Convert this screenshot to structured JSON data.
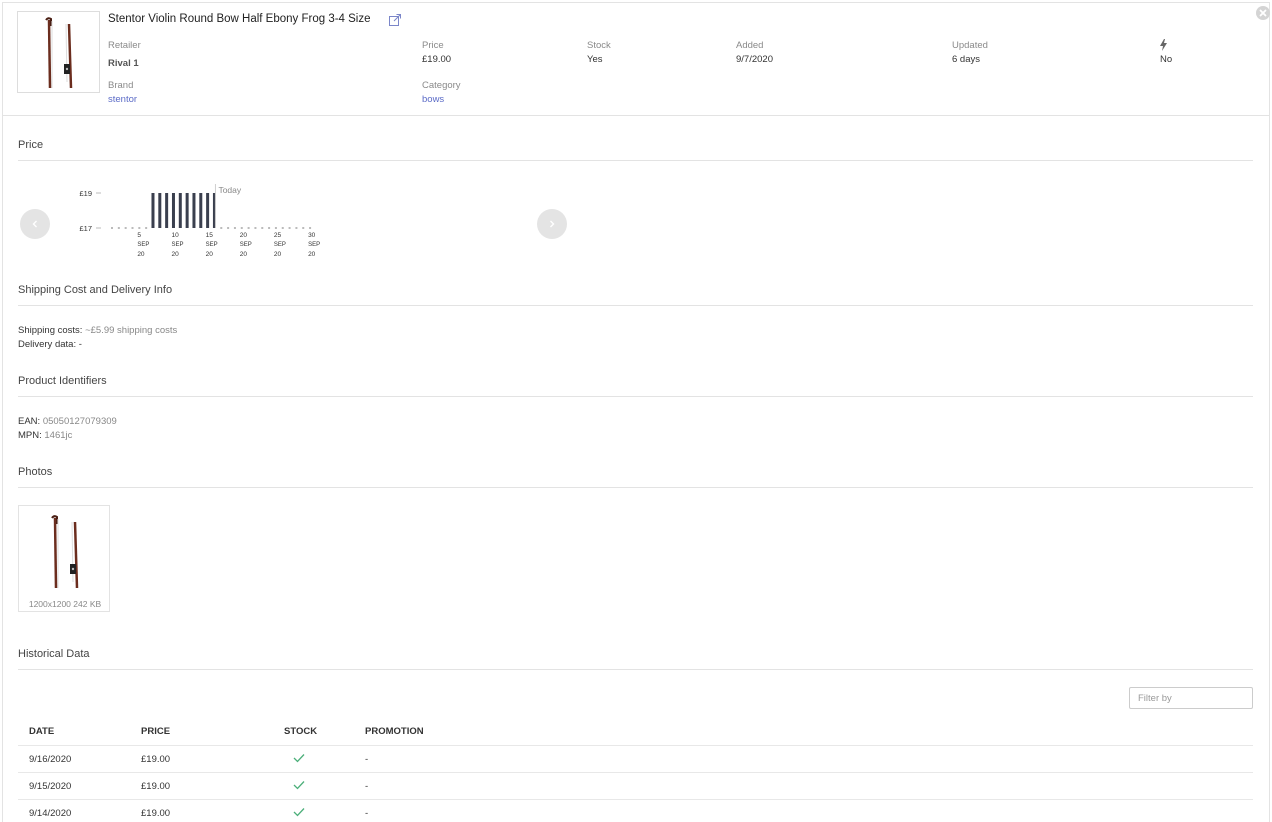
{
  "product": {
    "title": "Stentor Violin Round Bow Half Ebony Frog 3-4 Size",
    "fields": {
      "retailer_label": "Retailer",
      "retailer_value": "Rival 1",
      "price_label": "Price",
      "price_value": "£19.00",
      "stock_label": "Stock",
      "stock_value": "Yes",
      "added_label": "Added",
      "added_value": "9/7/2020",
      "updated_label": "Updated",
      "updated_value": "6 days",
      "promo_value": "No",
      "brand_label": "Brand",
      "brand_value": "stentor",
      "category_label": "Category",
      "category_value": "bows"
    },
    "icons": {
      "external": "external-link-icon",
      "promo": "lightning-bolt-icon",
      "close": "close-icon"
    }
  },
  "sections": {
    "price": "Price",
    "shipping": "Shipping Cost and Delivery Info",
    "identifiers": "Product Identifiers",
    "photos": "Photos",
    "history": "Historical Data"
  },
  "chart_data": {
    "type": "bar",
    "y_tick_labels": [
      "£19",
      "£17"
    ],
    "ylim": [
      17,
      19
    ],
    "today_label": "Today",
    "x_tick_days": [
      "5",
      "10",
      "15",
      "20",
      "25",
      "30"
    ],
    "x_tick_month": "SEP",
    "x_tick_year": "20",
    "days": [
      1,
      2,
      3,
      4,
      5,
      6,
      7,
      8,
      9,
      10,
      11,
      12,
      13,
      14,
      15,
      16,
      17,
      18,
      19,
      20,
      21,
      22,
      23,
      24,
      25,
      26,
      27,
      28,
      29,
      30
    ],
    "values": [
      null,
      null,
      null,
      null,
      null,
      null,
      19,
      19,
      19,
      19,
      19,
      19,
      19,
      19,
      19,
      19,
      null,
      null,
      null,
      null,
      null,
      null,
      null,
      null,
      null,
      null,
      null,
      null,
      null,
      null
    ],
    "today_day": 16,
    "colors": {
      "bar": "#3a3f4e"
    }
  },
  "shipping": {
    "costs_label": "Shipping costs:",
    "costs_value": "~£5.99 shipping costs",
    "delivery_label": "Delivery data:",
    "delivery_value": "-"
  },
  "identifiers": {
    "ean_label": "EAN:",
    "ean_value": "05050127079309",
    "mpn_label": "MPN:",
    "mpn_value": "1461jc"
  },
  "photo": {
    "caption": "1200x1200 242 KB"
  },
  "history": {
    "filter_placeholder": "Filter by",
    "columns": [
      "DATE",
      "PRICE",
      "STOCK",
      "PROMOTION"
    ],
    "rows": [
      {
        "date": "9/16/2020",
        "price": "£19.00",
        "stock": "check-icon",
        "promotion": "-"
      },
      {
        "date": "9/15/2020",
        "price": "£19.00",
        "stock": "check-icon",
        "promotion": "-"
      },
      {
        "date": "9/14/2020",
        "price": "£19.00",
        "stock": "check-icon",
        "promotion": "-"
      }
    ]
  },
  "colors": {
    "accent": "#5b6bc7",
    "check": "#4caf7a"
  }
}
